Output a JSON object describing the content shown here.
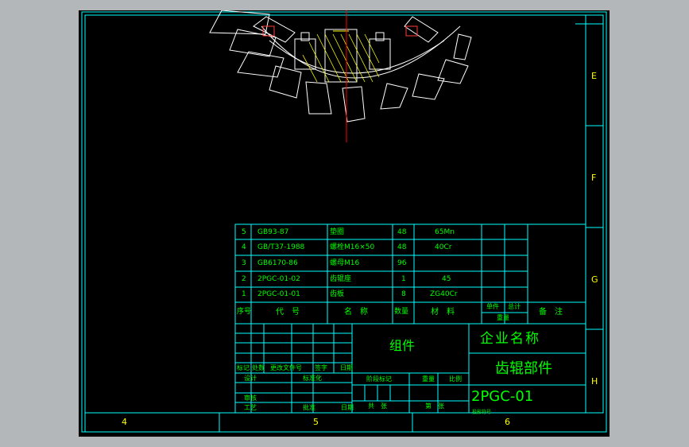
{
  "window": {
    "background": "#b4b7ba",
    "canvas_background": "#000000"
  },
  "colors": {
    "frame": "#00ffff",
    "linework": "#ffffff",
    "text": "#00ff00",
    "centerline": "#ff0000",
    "hatch": "#ffff00"
  },
  "zones": {
    "right": [
      "E",
      "F",
      "G",
      "H"
    ],
    "bottom": [
      "4",
      "5",
      "6"
    ]
  },
  "parts_list": {
    "rows": [
      {
        "no": "5",
        "code": "GB93-87",
        "name": "垫圈",
        "qty": "48",
        "material": "65Mn"
      },
      {
        "no": "4",
        "code": "GB/T37-1988",
        "name": "螺栓M16×50",
        "qty": "48",
        "material": "40Cr"
      },
      {
        "no": "3",
        "code": "GB6170-86",
        "name": "螺母M16",
        "qty": "96",
        "material": ""
      },
      {
        "no": "2",
        "code": "2PGC-01-02",
        "name": "齿辊座",
        "qty": "1",
        "material": "45"
      },
      {
        "no": "1",
        "code": "2PGC-01-01",
        "name": "齿板",
        "qty": "8",
        "material": "ZG40Cr"
      }
    ],
    "header": {
      "no": "序号",
      "code": "代　号",
      "name": "名　称",
      "qty": "数量",
      "material": "材　料",
      "single_weight": "单件",
      "total_weight": "总计",
      "weight": "重量",
      "remark": "备　注"
    }
  },
  "title_block": {
    "assembly": "组件",
    "company": "企业名称",
    "drawing_name": "齿辊部件",
    "drawing_no": "2PGC-01",
    "rev_labels": {
      "mark": "标记",
      "count": "处数",
      "doc": "更改文件号",
      "sign": "签字",
      "date": "日期"
    },
    "roles": {
      "design": "设计",
      "standard": "标准化",
      "review": "审核",
      "process": "工艺",
      "approve": "批准"
    },
    "stage": "阶段标记",
    "weight": "重量",
    "scale": "比例",
    "sheets": "共　张",
    "sheet": "第　张",
    "projection": "投影符号",
    "date_label": "日期"
  }
}
